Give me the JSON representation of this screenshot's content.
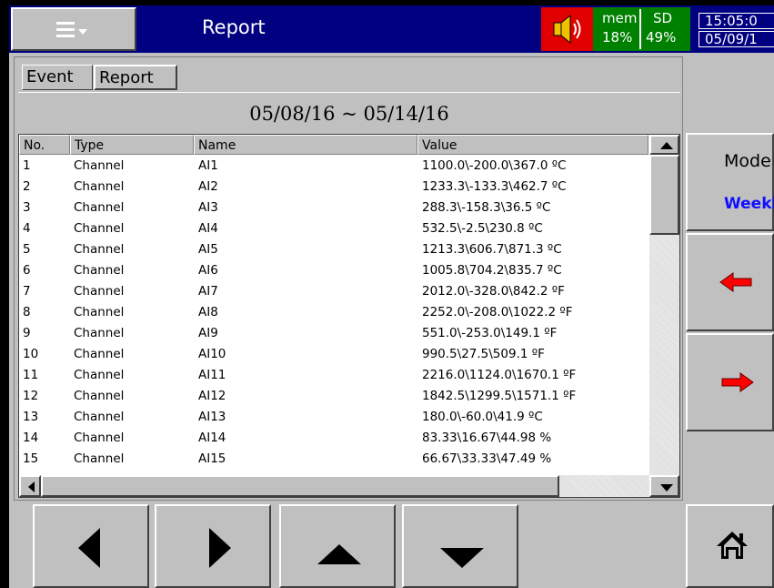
{
  "titlebar": {
    "title": "Report",
    "mem_label": "mem",
    "mem_value": "18%",
    "sd_label": "SD",
    "sd_value": "49%",
    "time": "15:05:0",
    "date": "05/09/1"
  },
  "tabs": [
    {
      "label": "Event",
      "active": false
    },
    {
      "label": "Report",
      "active": true
    }
  ],
  "date_range": "05/08/16 ~ 05/14/16",
  "table": {
    "headers": [
      "No.",
      "Type",
      "Name",
      "Value"
    ],
    "rows": [
      {
        "no": "1",
        "type": "Channel",
        "name": "AI1",
        "value": "1100.0\\-200.0\\367.0 ºC"
      },
      {
        "no": "2",
        "type": "Channel",
        "name": "AI2",
        "value": "1233.3\\-133.3\\462.7 ºC"
      },
      {
        "no": "3",
        "type": "Channel",
        "name": "AI3",
        "value": "288.3\\-158.3\\36.5 ºC"
      },
      {
        "no": "4",
        "type": "Channel",
        "name": "AI4",
        "value": "532.5\\-2.5\\230.8 ºC"
      },
      {
        "no": "5",
        "type": "Channel",
        "name": "AI5",
        "value": "1213.3\\606.7\\871.3 ºC"
      },
      {
        "no": "6",
        "type": "Channel",
        "name": "AI6",
        "value": "1005.8\\704.2\\835.7 ºC"
      },
      {
        "no": "7",
        "type": "Channel",
        "name": "AI7",
        "value": "2012.0\\-328.0\\842.2 ºF"
      },
      {
        "no": "8",
        "type": "Channel",
        "name": "AI8",
        "value": "2252.0\\-208.0\\1022.2 ºF"
      },
      {
        "no": "9",
        "type": "Channel",
        "name": "AI9",
        "value": "551.0\\-253.0\\149.1 ºF"
      },
      {
        "no": "10",
        "type": "Channel",
        "name": "AI10",
        "value": "990.5\\27.5\\509.1 ºF"
      },
      {
        "no": "11",
        "type": "Channel",
        "name": "AI11",
        "value": "2216.0\\1124.0\\1670.1 ºF"
      },
      {
        "no": "12",
        "type": "Channel",
        "name": "AI12",
        "value": "1842.5\\1299.5\\1571.1 ºF"
      },
      {
        "no": "13",
        "type": "Channel",
        "name": "AI13",
        "value": "180.0\\-60.0\\41.9 ºC"
      },
      {
        "no": "14",
        "type": "Channel",
        "name": "AI14",
        "value": "83.33\\16.67\\44.98 %"
      },
      {
        "no": "15",
        "type": "Channel",
        "name": "AI15",
        "value": "66.67\\33.33\\47.49 %"
      }
    ]
  },
  "mode": {
    "label": "Mode",
    "value": "Weekly"
  },
  "icons": {
    "menu": "menu-icon",
    "speaker": "speaker-icon",
    "prev": "red-left-arrow-icon",
    "next": "red-right-arrow-icon",
    "home": "home-icon"
  },
  "colors": {
    "titlebar": "#000080",
    "speaker_bg": "#e00000",
    "status_bg": "#008000",
    "mode_value": "#1010ff",
    "arrow_red": "#ff0000"
  }
}
